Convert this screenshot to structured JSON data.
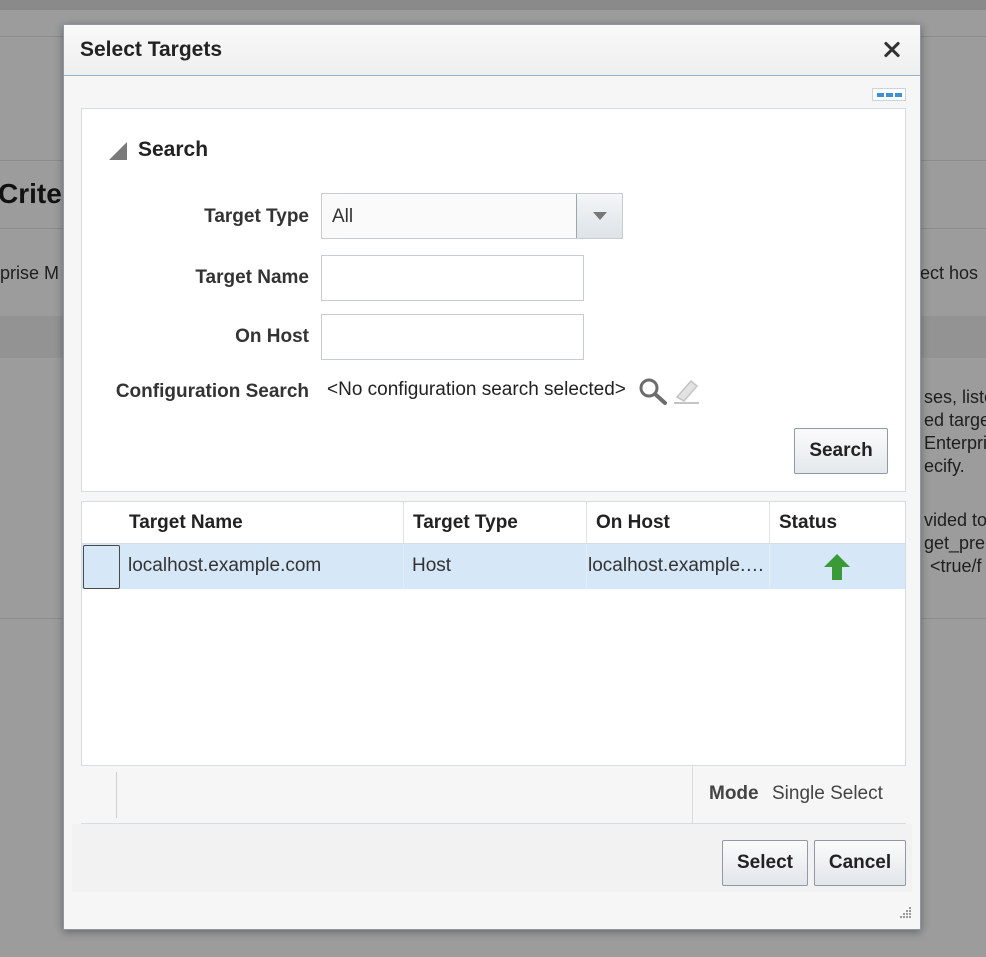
{
  "background": {
    "heading_fragment": "Criter",
    "text_left": "prise M",
    "text_right_1": "ect hos",
    "text_right_lines": [
      "ses, liste",
      "ed targe",
      "Enterpris",
      "ecify.",
      "vided to",
      "get_pre",
      "<true/f"
    ]
  },
  "dialog": {
    "title": "Select Targets",
    "close_icon": "close-icon",
    "more_icon": "more-options-icon"
  },
  "search": {
    "section_title": "Search",
    "target_type_label": "Target Type",
    "target_type_value": "All",
    "target_name_label": "Target Name",
    "target_name_value": "",
    "on_host_label": "On Host",
    "on_host_value": "",
    "config_search_label": "Configuration Search",
    "config_search_value": "<No configuration search selected>",
    "search_icon": "search-icon",
    "clear_icon": "eraser-icon",
    "search_button": "Search"
  },
  "table": {
    "columns": [
      "Target Name",
      "Target Type",
      "On Host",
      "Status"
    ],
    "rows": [
      {
        "target_name": "localhost.example.com",
        "target_type": "Host",
        "on_host": "localhost.example.com",
        "status_icon": "status-up-icon",
        "status_color": "#3a9a37"
      }
    ]
  },
  "footer": {
    "mode_label": "Mode",
    "mode_value": "Single Select",
    "select_button": "Select",
    "cancel_button": "Cancel"
  }
}
